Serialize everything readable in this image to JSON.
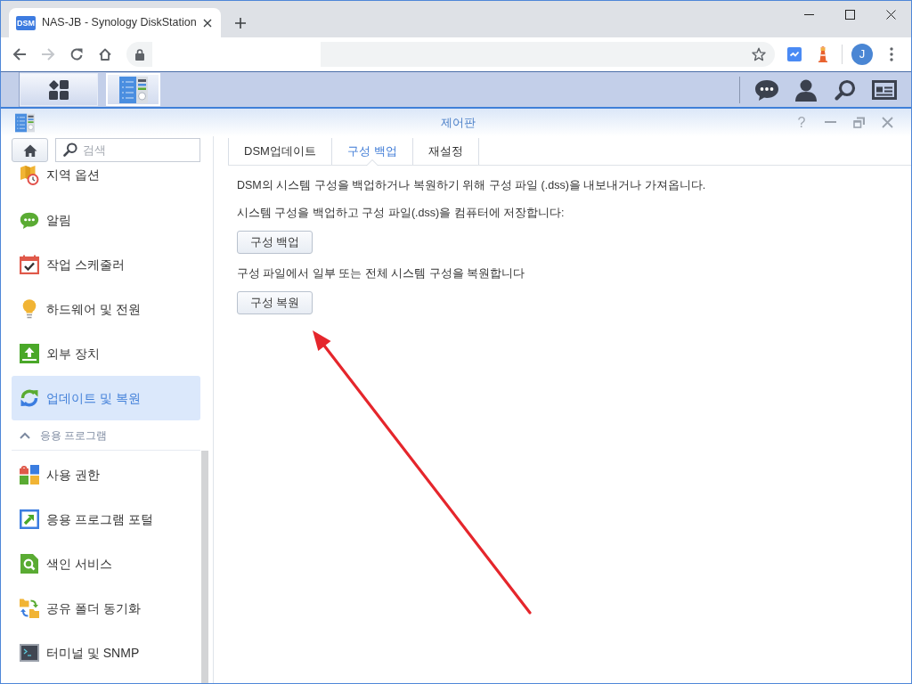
{
  "browser": {
    "tab": {
      "favicon": "DSM",
      "title": "NAS-JB - Synology DiskStation"
    },
    "forward_enabled": false,
    "profile_initial": "J"
  },
  "taskbar": {
    "apps": [
      {
        "selected": true
      }
    ]
  },
  "window": {
    "title": "제어판",
    "help": "?"
  },
  "sidebar": {
    "search": {
      "placeholder": "검색"
    },
    "groups": [
      {
        "items": [
          {
            "label": "지역 옵션",
            "selected": false
          },
          {
            "label": "알림",
            "selected": false
          },
          {
            "label": "작업 스케줄러",
            "selected": false
          },
          {
            "label": "하드웨어 및 전원",
            "selected": false
          },
          {
            "label": "외부 장치",
            "selected": false
          },
          {
            "label": "업데이트 및 복원",
            "selected": true
          }
        ]
      },
      {
        "title": "응용 프로그램",
        "expanded": true,
        "items": [
          {
            "label": "사용 권한",
            "selected": false
          },
          {
            "label": "응용 프로그램 포털",
            "selected": false
          },
          {
            "label": "색인 서비스",
            "selected": false
          },
          {
            "label": "공유 폴더 동기화",
            "selected": false
          },
          {
            "label": "터미널 및 SNMP",
            "selected": false
          }
        ]
      }
    ]
  },
  "tabs": [
    {
      "label": "DSM업데이트",
      "selected": false
    },
    {
      "label": "구성 백업",
      "selected": true
    },
    {
      "label": "재설정",
      "selected": false
    }
  ],
  "content": {
    "intro": "DSM의 시스템 구성을 백업하거나 복원하기 위해 구성 파일 (.dss)을 내보내거나 가져옵니다.",
    "sections": [
      {
        "text": "시스템 구성을 백업하고 구성 파일(.dss)을 컴퓨터에 저장합니다:",
        "button": "구성 백업"
      },
      {
        "text": "구성 파일에서 일부 또는 전체 시스템 구성을 복원합니다",
        "button": "구성 복원"
      }
    ]
  }
}
